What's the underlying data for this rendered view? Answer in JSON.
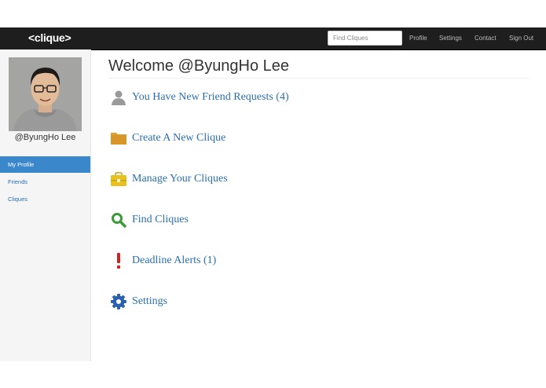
{
  "navbar": {
    "brand": "<clique>",
    "search_placeholder": "Find Cliques",
    "links": [
      "Profile",
      "Settings",
      "Contact",
      "Sign Out"
    ]
  },
  "sidebar": {
    "username": "@ByungHo Lee",
    "items": [
      {
        "label": "My Profile",
        "active": true
      },
      {
        "label": "Friends",
        "active": false
      },
      {
        "label": "Cliques",
        "active": false
      }
    ]
  },
  "main": {
    "title": "Welcome @ByungHo Lee",
    "actions": [
      {
        "label": "You Have New Friend Requests (4)",
        "icon": "user-icon"
      },
      {
        "label": "Create A New Clique",
        "icon": "folder-icon"
      },
      {
        "label": "Manage Your Cliques",
        "icon": "briefcase-icon"
      },
      {
        "label": "Find Cliques",
        "icon": "search-icon"
      },
      {
        "label": "Deadline Alerts (1)",
        "icon": "exclamation-icon"
      },
      {
        "label": "Settings",
        "icon": "gear-icon"
      }
    ]
  },
  "colors": {
    "navbar": "#1e1e1e",
    "link": "#2a6fb0",
    "active_item": "#3a87cc",
    "folder": "#e0a030",
    "briefcase": "#e8c020",
    "search": "#3a9a3a",
    "alert": "#d42020",
    "gear": "#2a60b0"
  }
}
